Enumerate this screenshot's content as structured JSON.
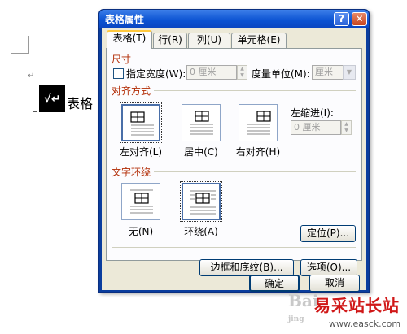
{
  "document": {
    "para_mark": "↵",
    "cell_text": "√↵",
    "word": "表格",
    "trail_mark": "↵"
  },
  "dialog": {
    "title": "表格属性",
    "help": "?",
    "close": "✕",
    "tabs": [
      "表格(T)",
      "行(R)",
      "列(U)",
      "单元格(E)"
    ],
    "size": {
      "section": "尺寸",
      "preferred_width_label": "指定宽度(W):",
      "preferred_width_value": "0 厘米",
      "measure_label": "度量单位(M):",
      "measure_value": "厘米"
    },
    "alignment": {
      "section": "对齐方式",
      "options": [
        "左对齐(L)",
        "居中(C)",
        "右对齐(H)"
      ],
      "indent_label": "左缩进(I):",
      "indent_value": "0 厘米"
    },
    "wrapping": {
      "section": "文字环绕",
      "options": [
        "无(N)",
        "环绕(A)"
      ],
      "positioning": "定位(P)..."
    },
    "borders": "边框和底纹(B)...",
    "options": "选项(O)...",
    "ok": "确定",
    "cancel": "取消"
  },
  "watermark": {
    "logo": "Bai",
    "sub": "jing",
    "site_cn": "易采站长站",
    "url": "www.easck.com"
  },
  "colors": {
    "section_title": "#b22c05",
    "titlebar": "#0b52d2",
    "dialog_face": "#ece9d8",
    "watermark": "#d01818"
  }
}
